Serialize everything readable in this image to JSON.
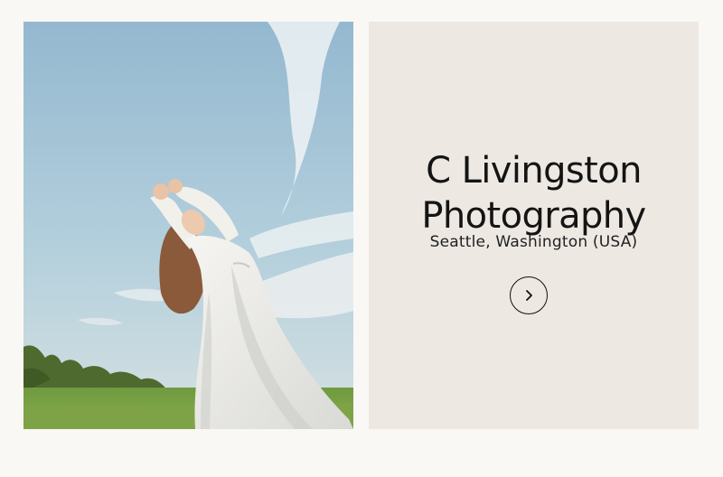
{
  "listing": {
    "title_line1": "C Livingston",
    "title_line2": "Photography",
    "location": "Seattle, Washington (USA)",
    "open_icon": "chevron-right-icon"
  },
  "colors": {
    "page_background": "#f9f8f4",
    "card_background": "#ede8e2",
    "text": "#141414"
  }
}
